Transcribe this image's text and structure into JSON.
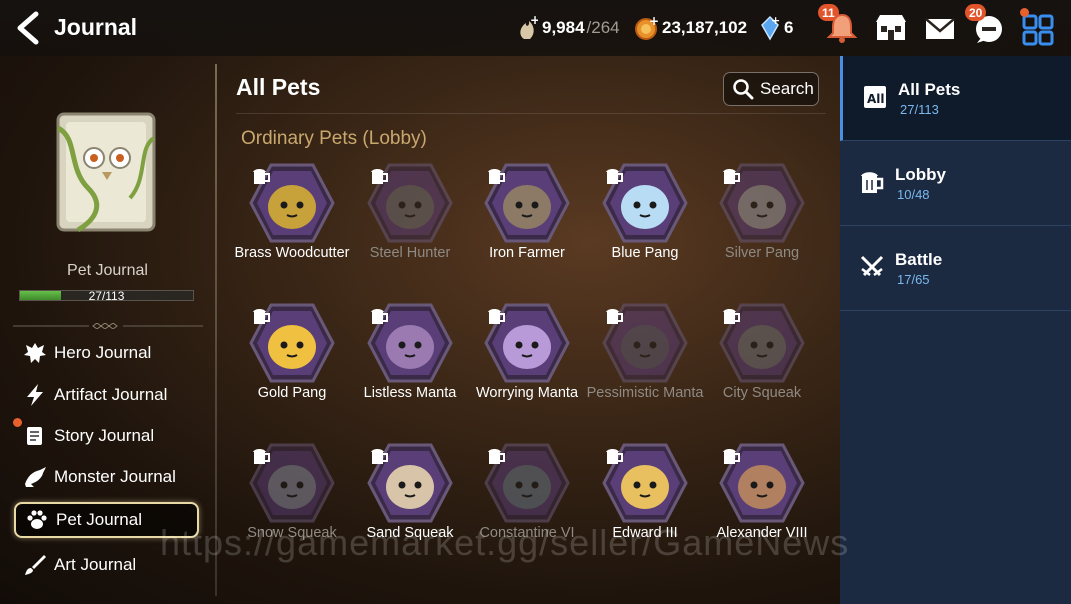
{
  "header": {
    "title": "Journal",
    "stamina": {
      "value": "9,984",
      "max": "/264"
    },
    "gold": "23,187,102",
    "crystals": "6",
    "notifications_badge": "11",
    "chat_badge": "20"
  },
  "left": {
    "journal_name": "Pet Journal",
    "progress": {
      "text": "27/113",
      "fraction": 0.239
    },
    "nav": [
      {
        "label": "Hero Journal",
        "icon": "hero-icon"
      },
      {
        "label": "Artifact Journal",
        "icon": "lightning-icon"
      },
      {
        "label": "Story Journal",
        "icon": "scroll-icon"
      },
      {
        "label": "Monster Journal",
        "icon": "dragon-icon"
      },
      {
        "label": "Pet Journal",
        "icon": "paw-icon"
      },
      {
        "label": "Art Journal",
        "icon": "brush-icon"
      }
    ]
  },
  "main": {
    "title": "All Pets",
    "search_label": "Search",
    "section_title": "Ordinary Pets (Lobby)",
    "pets": [
      {
        "name": "Brass Woodcutter",
        "locked": false,
        "color": "#c7a23a"
      },
      {
        "name": "Steel Hunter",
        "locked": true,
        "color": "#6b6b70"
      },
      {
        "name": "Iron Farmer",
        "locked": false,
        "color": "#8c7a66"
      },
      {
        "name": "Blue Pang",
        "locked": false,
        "color": "#b9dcf5"
      },
      {
        "name": "Silver Pang",
        "locked": true,
        "color": "#9a9aa0"
      },
      {
        "name": "Gold Pang",
        "locked": false,
        "color": "#f0c040"
      },
      {
        "name": "Listless Manta",
        "locked": false,
        "color": "#9a7ab0"
      },
      {
        "name": "Worrying Manta",
        "locked": false,
        "color": "#b89ad8"
      },
      {
        "name": "Pessimistic Manta",
        "locked": true,
        "color": "#5a5870"
      },
      {
        "name": "City Squeak",
        "locked": true,
        "color": "#707078"
      },
      {
        "name": "Snow Squeak",
        "locked": true,
        "color": "#8a8ca0"
      },
      {
        "name": "Sand Squeak",
        "locked": false,
        "color": "#d8c4a8"
      },
      {
        "name": "Constantine VI",
        "locked": true,
        "color": "#6a7888"
      },
      {
        "name": "Edward III",
        "locked": false,
        "color": "#e8c060"
      },
      {
        "name": "Alexander VIII",
        "locked": false,
        "color": "#b08060"
      }
    ]
  },
  "right": {
    "tabs": [
      {
        "label": "All Pets",
        "count": "27/113",
        "icon": "all-icon"
      },
      {
        "label": "Lobby",
        "count": "10/48",
        "icon": "mug-icon"
      },
      {
        "label": "Battle",
        "count": "17/65",
        "icon": "swords-icon"
      }
    ]
  },
  "watermark": "https://gamemarket.gg/seller/GameNews",
  "colors": {
    "accent_blue": "#4a90e2",
    "section_gold": "#c9a86e",
    "progress_green": "#4fa238",
    "panel_blue": "#1b2a40"
  }
}
